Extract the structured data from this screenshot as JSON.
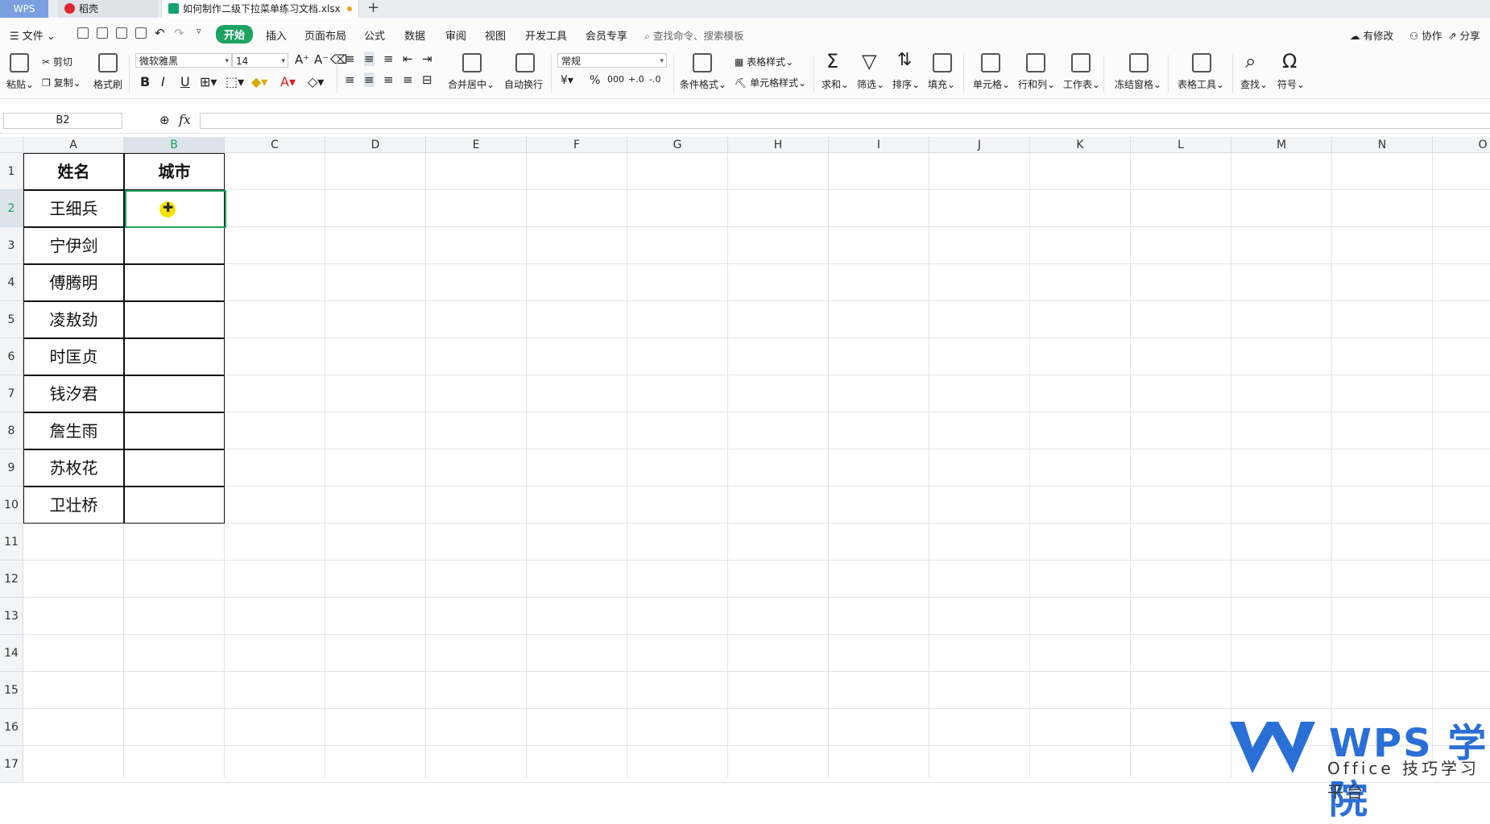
{
  "titlebar": {
    "wps_label": "WPS",
    "docer_label": "稻壳",
    "file_tab": "如何制作二级下拉菜单练习文档.xlsx"
  },
  "menubar": {
    "file": "文件",
    "items": [
      "开始",
      "插入",
      "页面布局",
      "公式",
      "数据",
      "审阅",
      "视图",
      "开发工具",
      "会员专享"
    ],
    "search_placeholder": "查找命令、搜索模板",
    "right": [
      "有修改",
      "协作",
      "分享"
    ]
  },
  "ribbon": {
    "paste": "粘贴",
    "cut": "剪切",
    "copy": "复制",
    "format_painter": "格式刷",
    "font_name": "微软雅黑",
    "font_size": "14",
    "bold": "B",
    "italic": "I",
    "underline": "U",
    "merge_center": "合并居中",
    "wrap_text": "自动换行",
    "number_format": "常规",
    "currency": "¥",
    "percent": "%",
    "thousands": "000",
    "inc_decimal": "+.0",
    "dec_decimal": "-.0",
    "table_style": "表格样式",
    "cond_format": "条件格式",
    "cell_style": "单元格样式",
    "sum": "求和",
    "filter": "筛选",
    "sort": "排序",
    "fill": "填充",
    "cell": "单元格",
    "row_col": "行和列",
    "worksheet": "工作表",
    "freeze": "冻结窗格",
    "table_tools": "表格工具",
    "find": "查找",
    "symbol": "符号"
  },
  "formula": {
    "namebox": "B2",
    "fx": "fx"
  },
  "columns": [
    "A",
    "B",
    "C",
    "D",
    "E",
    "F",
    "G",
    "H",
    "I",
    "J",
    "K",
    "L",
    "M",
    "N",
    "O"
  ],
  "rows": [
    "1",
    "2",
    "3",
    "4",
    "5",
    "6",
    "7",
    "8",
    "9",
    "10",
    "11",
    "12",
    "13",
    "14",
    "15",
    "16",
    "17"
  ],
  "table": {
    "header_a": "姓名",
    "header_b": "城市",
    "names": [
      "王细兵",
      "宁伊剑",
      "傅腾明",
      "凌敖劲",
      "时匡贞",
      "钱汐君",
      "詹生雨",
      "苏枚花",
      "卫壮桥"
    ]
  },
  "watermark": {
    "title": "WPS 学院",
    "subtitle": "Office 技巧学习平台"
  },
  "colors": {
    "accent": "#1ea362",
    "selection": "#1aa260",
    "brand_blue": "#2a6fd6"
  }
}
